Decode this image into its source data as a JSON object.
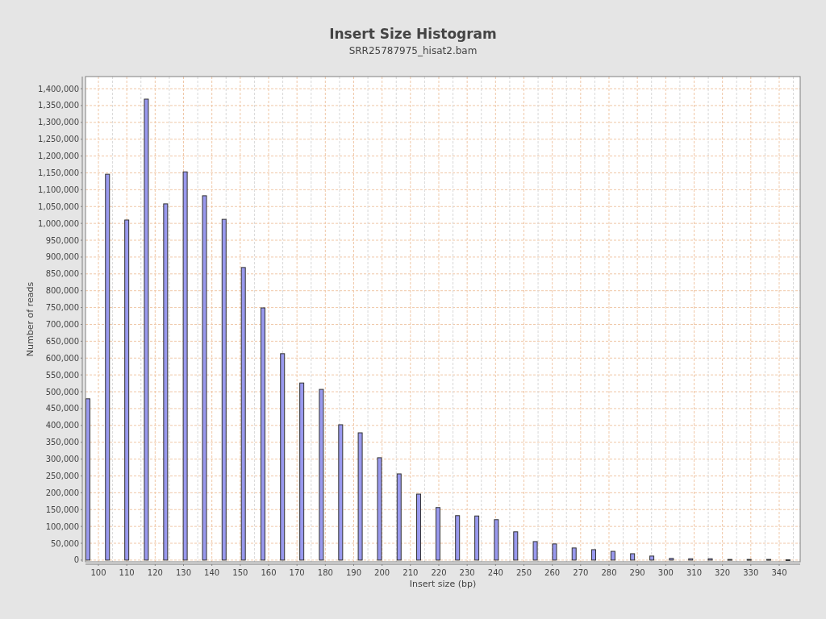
{
  "title": "Insert Size Histogram",
  "subtitle": "SRR25787975_hisat2.bam",
  "chart_data": {
    "type": "bar",
    "xlabel": "Insert size (bp)",
    "ylabel": "Number of reads",
    "x": [
      96.3,
      103.2,
      110.0,
      116.9,
      123.7,
      130.6,
      137.4,
      144.3,
      151.1,
      158.0,
      164.9,
      171.7,
      178.6,
      185.4,
      192.3,
      199.1,
      206.0,
      212.9,
      219.7,
      226.6,
      233.4,
      240.3,
      247.1,
      254.0,
      260.8,
      267.7,
      274.6,
      281.4,
      288.3,
      295.1,
      302.0,
      308.8,
      315.7,
      322.6,
      329.4,
      336.3,
      343.1
    ],
    "grid": true,
    "series": [
      {
        "color": "#9999ee",
        "values": [
          479000,
          1146000,
          1010000,
          1369000,
          1058000,
          1153000,
          1082000,
          1012000,
          869000,
          749000,
          613000,
          526000,
          507000,
          402000,
          378000,
          304000,
          256000,
          196000,
          156000,
          132000,
          131000,
          120000,
          84000,
          55000,
          48000,
          36000,
          31000,
          26000,
          19000,
          12000,
          5000,
          4000,
          4000,
          2000,
          2000,
          2000,
          1000
        ]
      }
    ],
    "xlim": [
      95.45,
      347.4
    ],
    "ylim": [
      -5000,
      1436000
    ],
    "xticks": [
      100,
      110,
      120,
      130,
      140,
      150,
      160,
      170,
      180,
      190,
      200,
      210,
      220,
      230,
      240,
      250,
      260,
      270,
      280,
      290,
      300,
      310,
      320,
      330,
      340
    ],
    "yticks": [
      {
        "value": 0,
        "label": "0"
      },
      {
        "value": 50000,
        "label": "50,000"
      },
      {
        "value": 100000,
        "label": "100,000"
      },
      {
        "value": 150000,
        "label": "150,000"
      },
      {
        "value": 200000,
        "label": "200,000"
      },
      {
        "value": 250000,
        "label": "250,000"
      },
      {
        "value": 300000,
        "label": "300,000"
      },
      {
        "value": 350000,
        "label": "350,000"
      },
      {
        "value": 400000,
        "label": "400,000"
      },
      {
        "value": 450000,
        "label": "450,000"
      },
      {
        "value": 500000,
        "label": "500,000"
      },
      {
        "value": 550000,
        "label": "550,000"
      },
      {
        "value": 600000,
        "label": "600,000"
      },
      {
        "value": 650000,
        "label": "650,000"
      },
      {
        "value": 700000,
        "label": "700,000"
      },
      {
        "value": 750000,
        "label": "750,000"
      },
      {
        "value": 800000,
        "label": "800,000"
      },
      {
        "value": 850000,
        "label": "850,000"
      },
      {
        "value": 900000,
        "label": "900,000"
      },
      {
        "value": 950000,
        "label": "950,000"
      },
      {
        "value": 1000000,
        "label": "1,000,000"
      },
      {
        "value": 1050000,
        "label": "1,050,000"
      },
      {
        "value": 1100000,
        "label": "1,100,000"
      },
      {
        "value": 1150000,
        "label": "1,150,000"
      },
      {
        "value": 1200000,
        "label": "1,200,000"
      },
      {
        "value": 1250000,
        "label": "1,250,000"
      },
      {
        "value": 1300000,
        "label": "1,300,000"
      },
      {
        "value": 1350000,
        "label": "1,350,000"
      },
      {
        "value": 1400000,
        "label": "1,400,000"
      }
    ]
  }
}
